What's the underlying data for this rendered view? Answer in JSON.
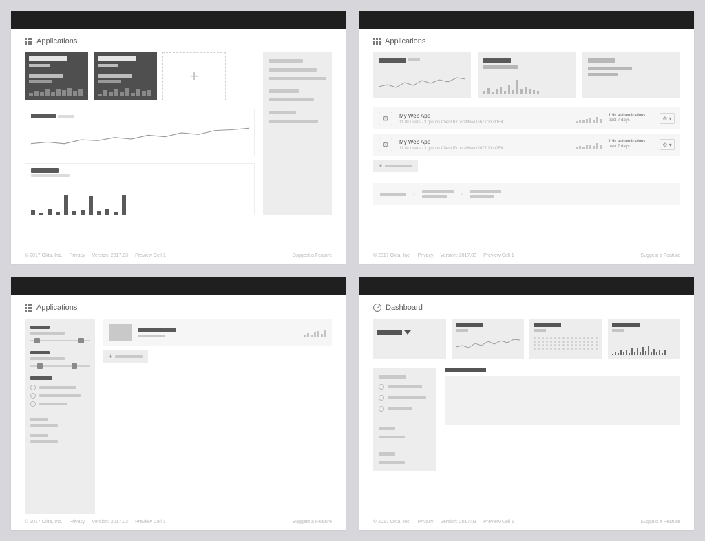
{
  "panels": {
    "p1": {
      "title": "Applications",
      "add": "+"
    },
    "p2": {
      "title": "Applications",
      "items": [
        {
          "title": "My Web App",
          "sub": "11.8k users · 3 groups      Client ID: xszMwvuLihZ7i2XxOE4",
          "stat_n": "1.9k authentications",
          "stat_t": "past 7 days"
        },
        {
          "title": "My Web App",
          "sub": "11.8k users · 3 groups      Client ID: xszMwvuLihZ7i2XxOE4",
          "stat_n": "1.9k authentications",
          "stat_t": "past 7 days"
        }
      ],
      "add": "+"
    },
    "p3": {
      "title": "Applications",
      "add": "+"
    },
    "p4": {
      "title": "Dashboard"
    }
  },
  "footer": {
    "copyright": "© 2017 Okta, Inc.",
    "privacy": "Privacy",
    "version": "Version: 2017.03",
    "preview": "Preview Cell 1",
    "suggest": "Suggest a Feature"
  },
  "chart_data": [
    {
      "panel": "p1-tile1",
      "type": "bar",
      "values": [
        5,
        8,
        7,
        11,
        6,
        10,
        9,
        12,
        8,
        10
      ]
    },
    {
      "panel": "p1-tile2",
      "type": "bar",
      "values": [
        4,
        9,
        6,
        10,
        7,
        12,
        5,
        11,
        8,
        9
      ]
    },
    {
      "panel": "p1-line",
      "type": "line",
      "x": [
        0,
        1,
        2,
        3,
        4,
        5,
        6,
        7,
        8,
        9,
        10,
        11,
        12
      ],
      "values": [
        22,
        24,
        23,
        26,
        25,
        28,
        27,
        30,
        29,
        32,
        31,
        34,
        35
      ]
    },
    {
      "panel": "p1-bars",
      "type": "bar",
      "values": [
        8,
        4,
        9,
        5,
        30,
        6,
        8,
        28,
        7,
        9,
        5,
        30
      ]
    },
    {
      "panel": "p2-tile1-spark",
      "type": "line",
      "x": [
        0,
        1,
        2,
        3,
        4,
        5,
        6,
        7,
        8,
        9,
        10
      ],
      "values": [
        8,
        10,
        7,
        12,
        9,
        14,
        11,
        15,
        13,
        17,
        16
      ]
    },
    {
      "panel": "p2-tile2-bars",
      "type": "bar",
      "values": [
        4,
        8,
        3,
        6,
        9,
        4,
        12,
        5,
        20,
        7,
        10,
        6,
        5,
        4
      ]
    },
    {
      "panel": "p2-item-bars",
      "type": "bar",
      "values": [
        3,
        5,
        4,
        6,
        7,
        5,
        9,
        6
      ]
    },
    {
      "panel": "p3-row-bars",
      "type": "bar",
      "values": [
        3,
        6,
        4,
        8,
        9,
        5,
        10
      ]
    },
    {
      "panel": "p4-tile2-spark",
      "type": "line",
      "x": [
        0,
        1,
        2,
        3,
        4,
        5,
        6,
        7,
        8,
        9,
        10
      ],
      "values": [
        6,
        8,
        5,
        10,
        7,
        12,
        9,
        13,
        11,
        15,
        14
      ]
    },
    {
      "panel": "p4-tile4-bars",
      "type": "bar",
      "values": [
        2,
        5,
        3,
        7,
        4,
        8,
        3,
        10,
        5,
        11,
        4,
        12,
        6,
        14,
        5,
        9,
        4,
        8,
        3,
        7
      ]
    }
  ]
}
